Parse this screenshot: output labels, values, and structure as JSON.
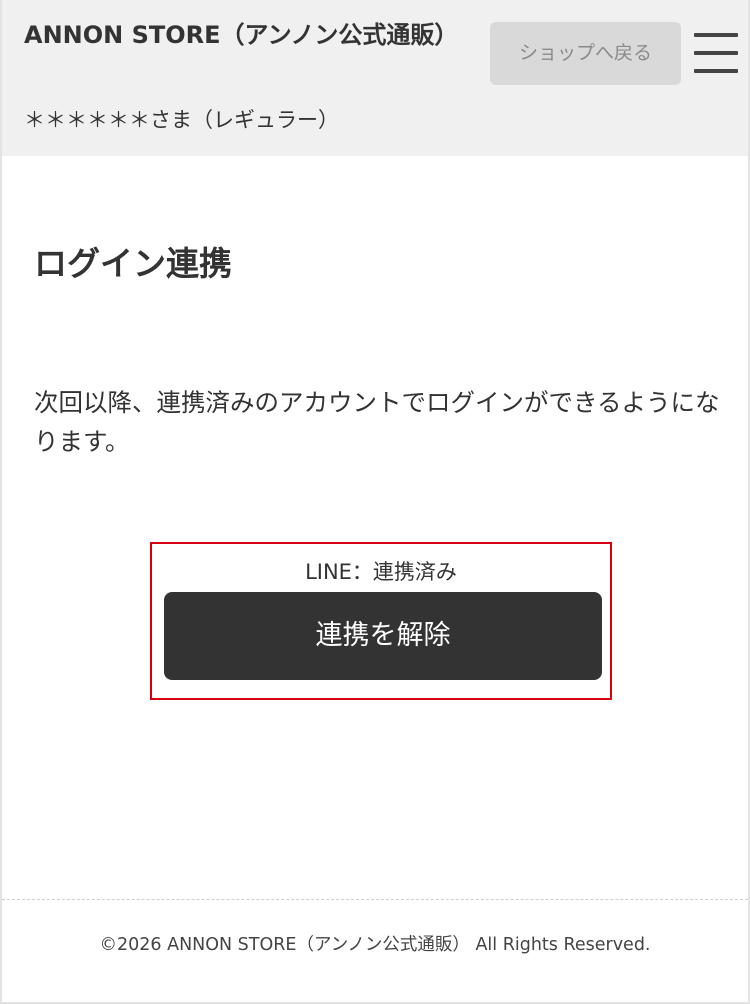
{
  "header": {
    "store_name": "ANNON STORE（アンノン公式通販）",
    "user_line": "＊＊＊＊＊＊さま（レギュラー）",
    "back_to_shop_label": "ショップへ戻る",
    "menu_icon": "hamburger-menu-icon"
  },
  "main": {
    "title": "ログイン連携",
    "description": "次回以降、連携済みのアカウントでログインができるようになります。",
    "link_status": "LINE：連携済み",
    "unlink_label": "連携を解除",
    "highlight_color": "#d8000f",
    "button_color": "#333333"
  },
  "footer": {
    "copyright": "©2026 ANNON STORE（アンノン公式通販） All Rights Reserved."
  }
}
